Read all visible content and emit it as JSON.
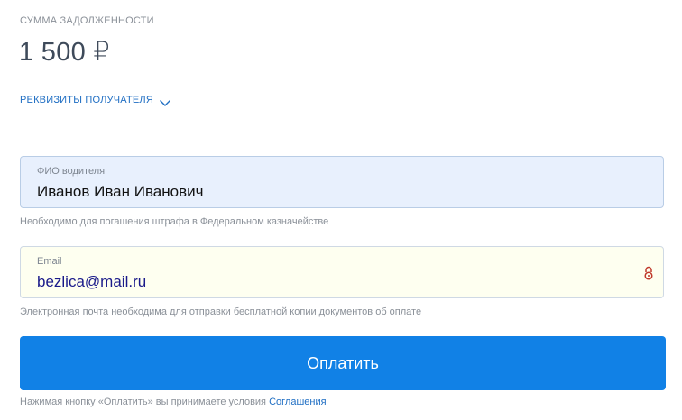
{
  "debt": {
    "label": "СУММА ЗАДОЛЖЕННОСТИ",
    "amount": "1 500 ₽"
  },
  "requisites": {
    "label": "РЕКВИЗИТЫ ПОЛУЧАТЕЛЯ",
    "icon": "chevron-down-icon"
  },
  "fio_field": {
    "label": "ФИО водителя",
    "value": "Иванов Иван Иванович",
    "hint": "Необходимо для погашения штрафа в Федеральном казначействе"
  },
  "email_field": {
    "label": "Email",
    "value": "bezlica@mail.ru",
    "hint": "Электронная почта необходима для отправки бесплатной копии документов об оплате",
    "icon": "lock-icon"
  },
  "pay_button": {
    "label": "Оплатить"
  },
  "agreement": {
    "text": "Нажимая кнопку «Оплатить» вы принимаете условия",
    "link": "Соглашения"
  },
  "colors": {
    "accent": "#1181e6",
    "link": "#1f6ec3",
    "lock": "#c0392b"
  }
}
